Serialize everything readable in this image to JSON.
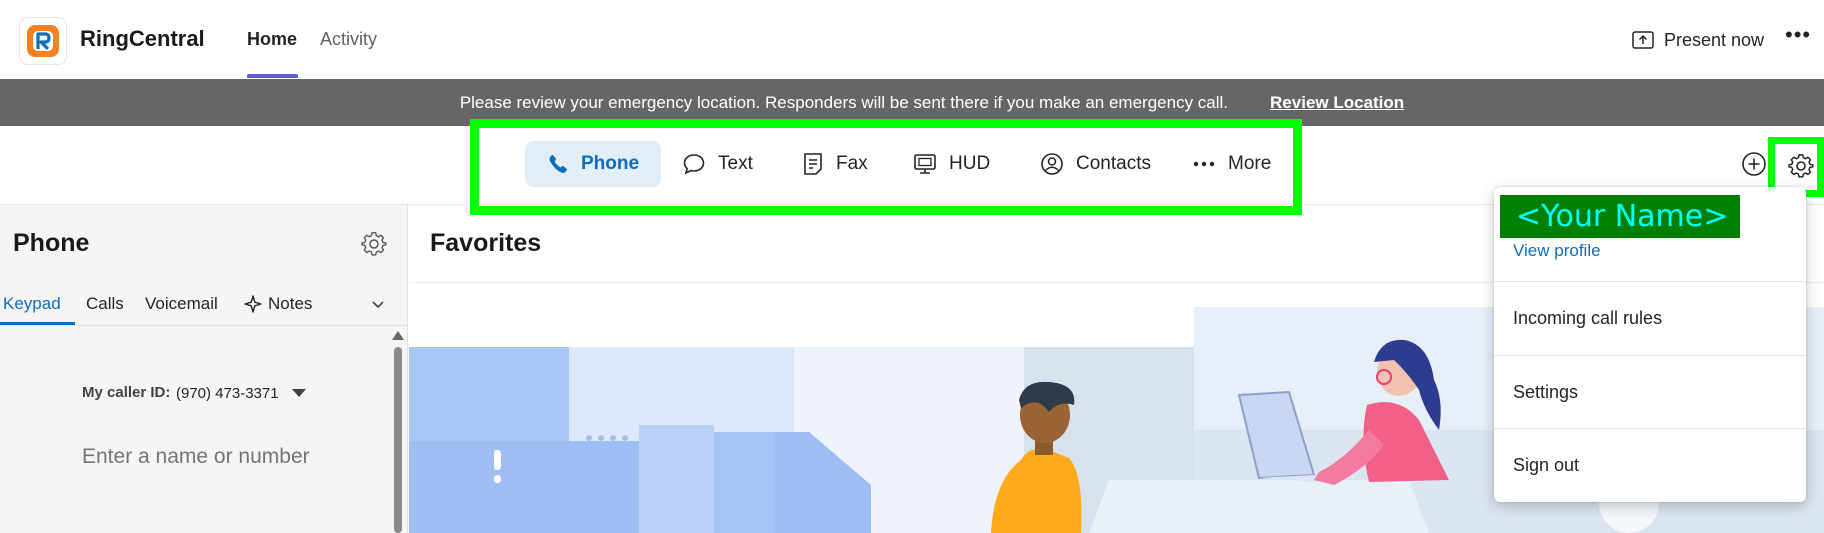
{
  "app": {
    "title": "RingCentral"
  },
  "header": {
    "tabs": [
      {
        "label": "Home",
        "active": true
      },
      {
        "label": "Activity",
        "active": false
      }
    ],
    "present_label": "Present now",
    "more_label": "•••"
  },
  "banner": {
    "message": "Please review your emergency location. Responders will be sent there if you make an emergency call.",
    "link": "Review Location"
  },
  "nav": {
    "items": [
      {
        "label": "Phone",
        "icon": "phone-icon",
        "active": true
      },
      {
        "label": "Text",
        "icon": "chat-bubble-icon"
      },
      {
        "label": "Fax",
        "icon": "fax-icon"
      },
      {
        "label": "HUD",
        "icon": "monitor-icon"
      },
      {
        "label": "Contacts",
        "icon": "contact-icon"
      },
      {
        "label": "More",
        "icon": "ellipsis-icon"
      }
    ]
  },
  "phone_panel": {
    "title": "Phone",
    "subtabs": [
      {
        "label": "Keypad",
        "active": true
      },
      {
        "label": "Calls"
      },
      {
        "label": "Voicemail"
      },
      {
        "label": "Notes"
      }
    ],
    "caller_id_label": "My caller ID:",
    "caller_id_value": "(970) 473-3371",
    "dial_placeholder": "Enter a name or number"
  },
  "main": {
    "title": "Favorites"
  },
  "profile_menu": {
    "name": "<Your Name>",
    "view_profile": "View profile",
    "items": [
      "Incoming call rules",
      "Settings",
      "Sign out"
    ]
  },
  "colors": {
    "accent": "#0f6cbd",
    "banner_bg": "#666666",
    "highlight": "#00ff00",
    "name_box_bg": "#008000",
    "name_box_text": "#00ffff"
  }
}
